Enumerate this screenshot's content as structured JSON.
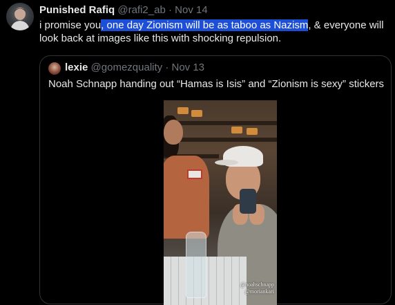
{
  "tweet": {
    "display_name": "Punished Rafiq",
    "handle": "@rafi2_ab",
    "separator": "·",
    "date": "Nov 14",
    "text_before": "i promise you",
    "text_highlight": ", one day Zionism will be as taboo as Nazism",
    "text_after": ", & everyone will look back at images like this with shocking repulsion."
  },
  "quoted": {
    "display_name": "lexie",
    "handle": "@gomezquality",
    "separator": "·",
    "date": "Nov 13",
    "text": "Noah Schnapp handing out “Hamas is Isis” and “Zionism is sexy” stickers",
    "watermark_lines": [
      "@noahschnapp",
      "@moriankari"
    ]
  },
  "colors": {
    "background": "#000000",
    "text": "#e7e9ea",
    "muted": "#71767b",
    "highlight": "#1d4ed8",
    "border": "#2f3336"
  },
  "icons": [
    "avatar",
    "quoted-avatar"
  ]
}
